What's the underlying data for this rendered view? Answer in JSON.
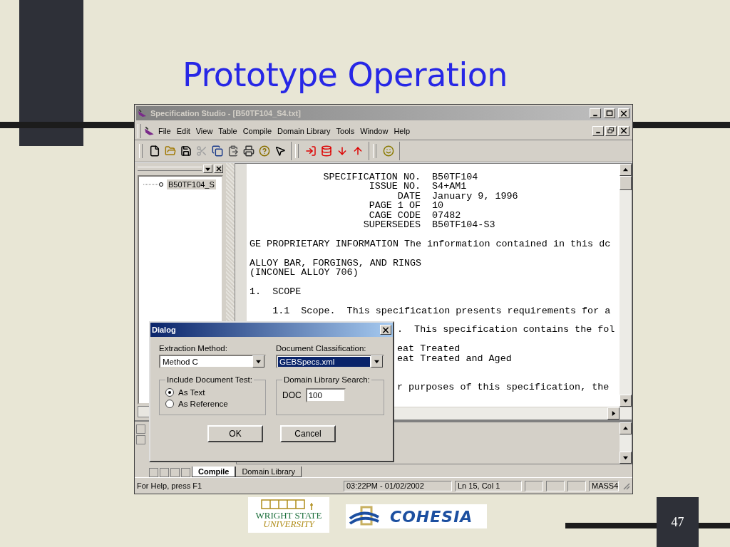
{
  "slide": {
    "title": "Prototype Operation",
    "page_number": "47"
  },
  "window": {
    "title": "Specification Studio - [B50TF104_S4.txt]",
    "active": false
  },
  "menu": [
    "File",
    "Edit",
    "View",
    "Table",
    "Compile",
    "Domain Library",
    "Tools",
    "Window",
    "Help"
  ],
  "toolbar": [
    [
      {
        "kind": "new",
        "disabled": false
      },
      {
        "kind": "open",
        "disabled": false
      },
      {
        "kind": "save",
        "disabled": false
      },
      {
        "kind": "cut",
        "disabled": true
      },
      {
        "kind": "copy",
        "disabled": false
      },
      {
        "kind": "paste",
        "disabled": false
      },
      {
        "kind": "print",
        "disabled": false
      },
      {
        "kind": "help",
        "disabled": false
      },
      {
        "kind": "context_help",
        "disabled": false
      }
    ],
    [
      {
        "kind": "import",
        "disabled": false
      },
      {
        "kind": "import_db",
        "disabled": false
      },
      {
        "kind": "down",
        "disabled": false
      },
      {
        "kind": "up",
        "disabled": false
      }
    ],
    [
      {
        "kind": "smiley",
        "disabled": false
      }
    ]
  ],
  "tree": {
    "items": [
      {
        "label": "B50TF104_S",
        "selected": true
      }
    ]
  },
  "document": {
    "header": [
      {
        "label": "SPECIFICATION NO.",
        "value": "B50TF104"
      },
      {
        "label": "ISSUE NO.",
        "value": "S4+AM1"
      },
      {
        "label": "DATE",
        "value": "January 9, 1996"
      },
      {
        "label": "PAGE 1 OF",
        "value": "10"
      },
      {
        "label": "CAGE CODE",
        "value": "07482"
      },
      {
        "label": "SUPERSEDES",
        "value": "B50TF104-S3"
      }
    ],
    "paragraphs": [
      {
        "kind": "full",
        "lines": [
          "GE PROPRIETARY INFORMATION The information contained in this dc"
        ]
      },
      {
        "kind": "full",
        "lines": [
          "ALLOY BAR, FORGINGS, AND RINGS",
          "(INCONEL ALLOY 706)"
        ]
      },
      {
        "kind": "full",
        "lines": [
          "1.  SCOPE"
        ]
      },
      {
        "kind": "indented",
        "lines": [
          "1.1  Scope.  This specification presents requirements for a"
        ]
      },
      {
        "kind": "cut",
        "lines": [
          ".  This specification contains the fol"
        ]
      },
      {
        "kind": "cut",
        "lines": [
          "eat Treated",
          "eat Treated and Aged"
        ]
      },
      {
        "kind": "cut",
        "follows_hidden_line": true,
        "lines": [
          "r purposes of this specification, the"
        ]
      }
    ]
  },
  "dialog": {
    "title": "Dialog",
    "active": true,
    "extraction": {
      "label": "Extraction Method:",
      "value": "Method C",
      "focused": false
    },
    "classification": {
      "label": "Document Classification:",
      "value": "GEBSpecs.xml",
      "focused": true
    },
    "include_group": {
      "title": "Include Document Test:",
      "options": [
        {
          "label": "As Text",
          "selected": true
        },
        {
          "label": "As Reference",
          "selected": false
        }
      ]
    },
    "search_group": {
      "title": "Domain Library Search:",
      "field_label": "DOC",
      "value": "100"
    },
    "buttons": [
      "OK",
      "Cancel"
    ]
  },
  "tabs": [
    {
      "label": "Compile",
      "selected": true
    },
    {
      "label": "Domain Library",
      "selected": false
    }
  ],
  "status_bar": {
    "help": "For Help, press F1",
    "time": "03:22PM - 01/02/2002",
    "position": "Ln 15, Col 1",
    "mode": "MASS4"
  },
  "logos": [
    {
      "kind": "wright_state",
      "lines": [
        "WRIGHT STATE",
        "UNIVERSITY"
      ]
    },
    {
      "kind": "cohesia",
      "text": "COHESIA"
    }
  ]
}
